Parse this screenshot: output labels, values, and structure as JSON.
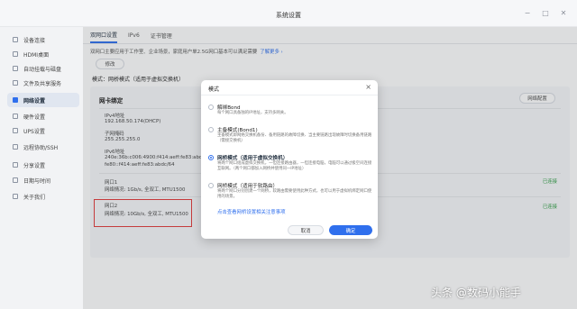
{
  "window": {
    "title": "系统设置",
    "controls": [
      "minimize-icon",
      "restore-icon",
      "close-icon"
    ]
  },
  "sidebar": {
    "items": [
      {
        "label": "设备连接",
        "icon": "device-link-icon",
        "active": false
      },
      {
        "label": "HDMI桌面",
        "icon": "hdmi-icon",
        "active": false
      },
      {
        "label": "自动挂载与磁盘",
        "icon": "disk-icon",
        "active": false
      },
      {
        "label": "文件及共享服务",
        "icon": "folder-share-icon",
        "active": false
      },
      {
        "label": "网络设置",
        "icon": "network-icon",
        "active": true
      },
      {
        "label": "硬件设置",
        "icon": "hardware-icon",
        "active": false
      },
      {
        "label": "UPS设置",
        "icon": "ups-icon",
        "active": false
      },
      {
        "label": "远程协助/SSH",
        "icon": "remote-icon",
        "active": false
      },
      {
        "label": "分享设置",
        "icon": "share-icon",
        "active": false
      },
      {
        "label": "日期与时间",
        "icon": "clock-icon",
        "active": false
      },
      {
        "label": "关于我们",
        "icon": "info-icon",
        "active": false
      }
    ]
  },
  "tabs": [
    {
      "label": "双网口设置",
      "active": true
    },
    {
      "label": "IPv6",
      "active": false
    },
    {
      "label": "证书管理",
      "active": false
    }
  ],
  "main": {
    "description": "双网口主要应用于工作室、企业场景，家庭用户单2.5G网口基本可以满足需要",
    "description_link": "了解更多 ›",
    "edit_button": "修改",
    "mode_label": "模式：网桥模式（适用于虚拟交换机）",
    "card": {
      "title": "网卡绑定",
      "config_button": "网络配置",
      "ipv4_label": "IPv4地址",
      "ipv4_value": "192.168.50.174(DHCP)",
      "mask_label": "子网掩码",
      "mask_value": "255.255.255.0",
      "ipv6_label": "IPv6地址",
      "ipv6_value_1": "240e:36b:c006:4900:f414:aeff:fe83:abdc/64",
      "ipv6_value_2": "fe80::f414:aeff:fe83:abdc/64",
      "port1_name": "网口1",
      "port1_status": "网络情况: 1Gb/s, 全双工, MTU1500",
      "port1_badge": "已连接",
      "port2_name": "网口2",
      "port2_status": "网络情况: 10Gb/s, 全双工, MTU1500",
      "port2_badge": "已连接"
    }
  },
  "modal": {
    "title": "模式",
    "options": [
      {
        "title": "解绑Bond",
        "desc": "每个网口具备独的IP地址，支持多网关。",
        "selected": false
      },
      {
        "title": "主备模式(Bond1)",
        "desc": "主备模式即网络交换机备份、备用链路的故障切换、当主要链路出现故障时切换备用链路（需接交换机）",
        "selected": false
      },
      {
        "title": "网桥模式（适用于虚拟交换机）",
        "desc": "将两个网口组成虚拟交换机，一但连接路由器，一但连接电脑，电脑可以通过极空间连接互联网。（两个网口都加入网桥并使用同一IP地址）",
        "selected": true
      },
      {
        "title": "网桥模式（适用于软路由）",
        "desc": "将两个网口分别创建一个网桥，软路由需要使用此种方式，也可以用于虚拟机绑定网口使用的场景。",
        "selected": false
      }
    ],
    "link": "点击查看网桥设置相关注意事项",
    "cancel_label": "取消",
    "ok_label": "确定"
  },
  "colors": {
    "accent": "#2f6fed",
    "success": "#2f9e44",
    "highlight": "#e33a3a"
  },
  "watermark": "头条 @数码小能手"
}
